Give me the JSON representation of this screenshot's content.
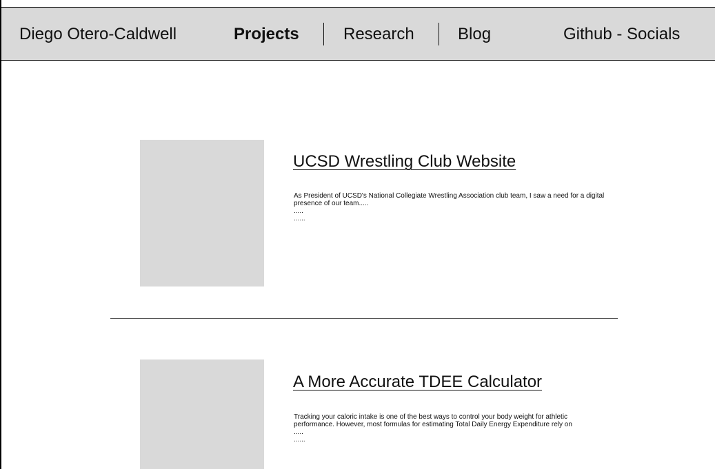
{
  "header": {
    "brand": "Diego Otero-Caldwell",
    "nav": {
      "projects": "Projects",
      "research": "Research",
      "blog": "Blog",
      "social": "Github - Socials"
    }
  },
  "projects": [
    {
      "title": "UCSD Wrestling Club Website",
      "description": "As President of UCSD's National Collegiate Wrestling Association club team, I saw a need for a digital presence of our team.....",
      "dots_1": ".....",
      "dots_2": "......"
    },
    {
      "title": "A More Accurate TDEE Calculator",
      "description": "Tracking your caloric intake is one of the best ways to control your body weight for athletic performance. However, most formulas for estimating Total Daily Energy Expenditure rely on",
      "dots_1": ".....",
      "dots_2": "......"
    }
  ],
  "colors": {
    "header_background": "#d9d9d9",
    "thumbnail_placeholder": "#d9d9d9",
    "text": "#111111",
    "divider": "#555555"
  }
}
